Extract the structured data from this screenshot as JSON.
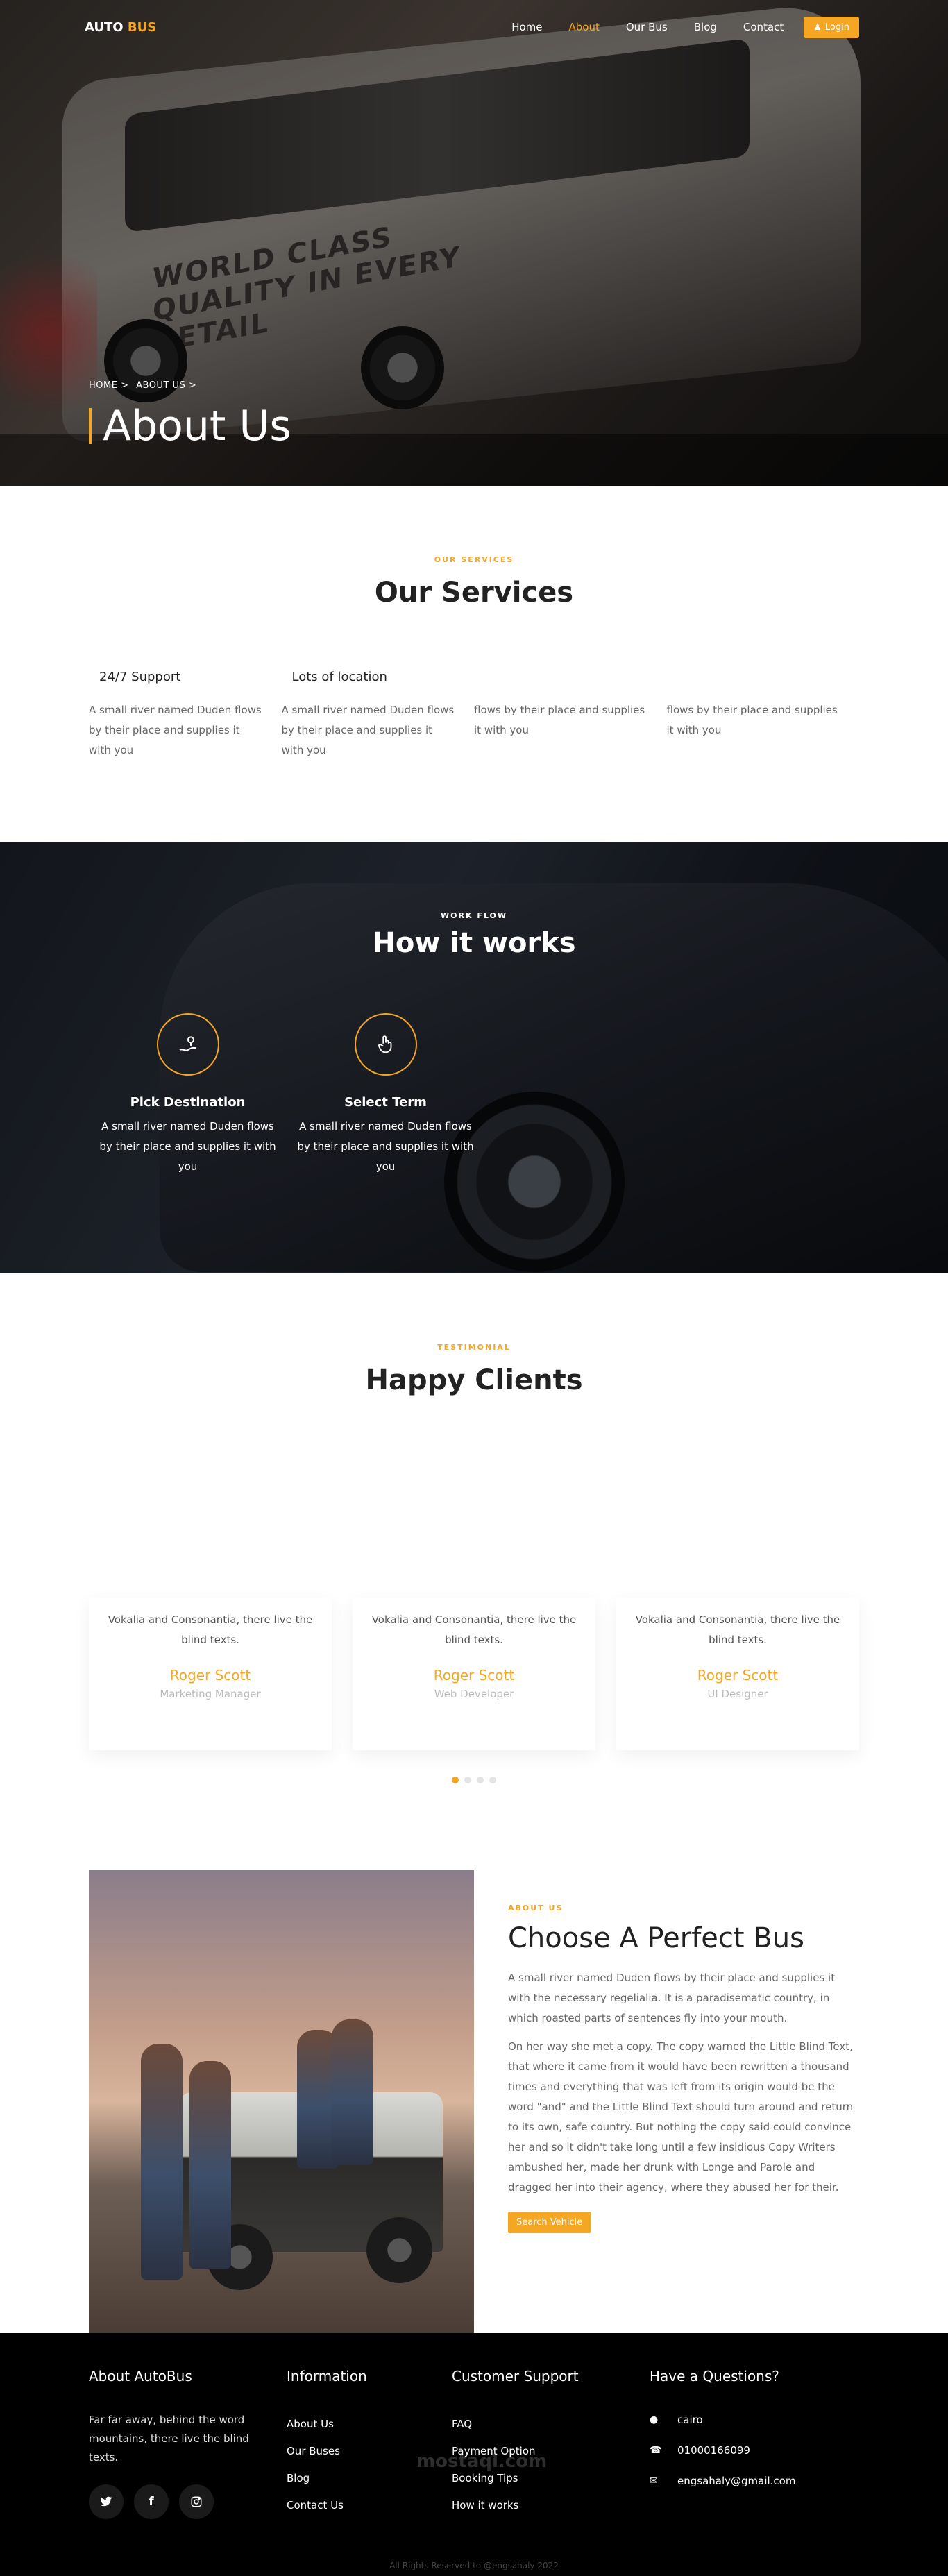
{
  "nav": {
    "logo_main": "AUTO",
    "logo_accent": "BUS",
    "items": [
      "Home",
      "About",
      "Our Bus",
      "Blog",
      "Contact"
    ],
    "active_index": 1,
    "login_label": "Login"
  },
  "hero": {
    "breadcrumb_home": "HOME >",
    "breadcrumb_current": "ABOUT US >",
    "title": "About Us",
    "bus_lettering": "WORLD CLASS QUALITY IN EVERY DETAIL"
  },
  "services": {
    "subheading": "OUR SERVICES",
    "heading": "Our Services",
    "items": [
      {
        "title": "24/7 Support",
        "text": "A small river named Duden flows by their place and supplies it with you"
      },
      {
        "title": "Lots of location",
        "text": "A small river named Duden flows by their place and supplies it with you"
      },
      {
        "title": "",
        "text": "flows by their place and supplies it with you"
      },
      {
        "title": "",
        "text": "flows by their place and supplies it with you"
      }
    ]
  },
  "works": {
    "subheading": "WORK FLOW",
    "heading": "How it works",
    "steps": [
      {
        "title": "Pick Destination",
        "text": "A small river named Duden flows by their place and supplies it with you",
        "icon": "map-pin-icon"
      },
      {
        "title": "Select Term",
        "text": "A small river named Duden flows by their place and supplies it with you",
        "icon": "hand-pointer-icon"
      }
    ]
  },
  "testimonials": {
    "subheading": "TESTIMONIAL",
    "heading": "Happy Clients",
    "items": [
      {
        "text": "Vokalia and Consonantia, there live the blind texts.",
        "name": "Roger Scott",
        "role": "Marketing Manager"
      },
      {
        "text": "Vokalia and Consonantia, there live the blind texts.",
        "name": "Roger Scott",
        "role": "Web Developer"
      },
      {
        "text": "Vokalia and Consonantia, there live the blind texts.",
        "name": "Roger Scott",
        "role": "UI Designer"
      }
    ],
    "active_dot": 0,
    "dot_count": 4
  },
  "about": {
    "subheading": "ABOUT US",
    "heading": "Choose A Perfect Bus",
    "p1": "A small river named Duden flows by their place and supplies it with the necessary regelialia. It is a paradisematic country, in which roasted parts of sentences fly into your mouth.",
    "p2": "On her way she met a copy. The copy warned the Little Blind Text, that where it came from it would have been rewritten a thousand times and everything that was left from its origin would be the word \"and\" and the Little Blind Text should turn around and return to its own, safe country. But nothing the copy said could convince her and so it didn't take long until a few insidious Copy Writers ambushed her, made her drunk with Longe and Parole and dragged her into their agency, where they abused her for their.",
    "button_label": "Search Vehicle"
  },
  "footer": {
    "about_title": "About AutoBus",
    "about_text": "Far far away, behind the word mountains, there live the blind texts.",
    "social": [
      "twitter-icon",
      "facebook-icon",
      "instagram-icon"
    ],
    "info_title": "Information",
    "info_links": [
      "About Us",
      "Our Buses",
      "Blog",
      "Contact Us"
    ],
    "support_title": "Customer Support",
    "support_links": [
      "FAQ",
      "Payment Option",
      "Booking Tips",
      "How it works"
    ],
    "contact_title": "Have a Questions?",
    "address": "cairo",
    "phone": "01000166099",
    "email": "engsahaly@gmail.com",
    "copyright": "All Rights Reserved to @engsahaly 2022",
    "watermark": "mostaql.com"
  },
  "colors": {
    "accent": "#f5a623",
    "dark": "#000000"
  }
}
